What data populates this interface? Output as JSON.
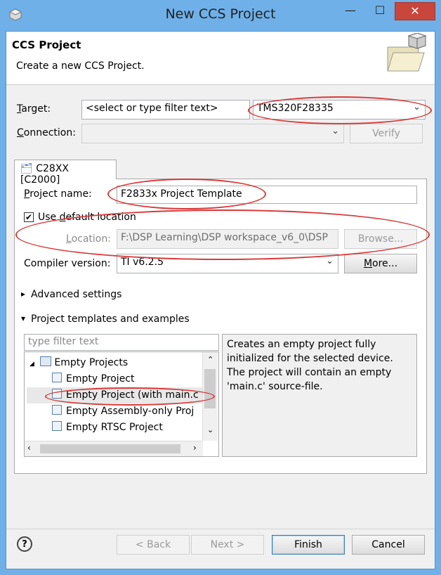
{
  "window": {
    "title": "New CCS Project",
    "min_icon": "—",
    "max_icon": "☐",
    "close_icon": "✕"
  },
  "header": {
    "title": "CCS Project",
    "description": "Create a new CCS Project."
  },
  "target": {
    "label_pre": "",
    "label_u": "T",
    "label_post": "arget:",
    "filter_placeholder": "<select or type filter text>",
    "value": "TMS320F28335"
  },
  "connection": {
    "label_u": "C",
    "label_post": "onnection:",
    "value": "",
    "verify_label": "Verify"
  },
  "tab": {
    "label": "C28XX [C2000]"
  },
  "project": {
    "name_label_u": "P",
    "name_label_post": "roject name:",
    "name_value": "F2833x Project Template",
    "use_default_label_pre": "Use ",
    "use_default_label_u": "d",
    "use_default_label_post": "efault location",
    "use_default_checked": "✔",
    "location_label_u": "L",
    "location_label_post": "ocation:",
    "location_value": "F:\\DSP Learning\\DSP workspace_v6_0\\DSP",
    "browse_label": "Browse...",
    "compiler_label": "Compiler version:",
    "compiler_value": "TI v6.2.5",
    "more_label_u": "M",
    "more_label_post": "ore..."
  },
  "sections": {
    "advanced": "Advanced settings",
    "templates": "Project templates and examples",
    "collapsed_arrow": "▸",
    "expanded_arrow": "▾"
  },
  "templates": {
    "filter_placeholder": "type filter text",
    "tree": [
      {
        "label": "Empty Projects",
        "indent": 0,
        "expander": "◢"
      },
      {
        "label": "Empty Project",
        "indent": 1
      },
      {
        "label": "Empty Project (with main.c",
        "indent": 1,
        "selected": true
      },
      {
        "label": "Empty Assembly-only Proj",
        "indent": 1
      },
      {
        "label": "Empty RTSC Project",
        "indent": 1
      }
    ],
    "description": "Creates an empty project fully initialized for the selected device. The project will contain an empty 'main.c' source-file."
  },
  "footer": {
    "help_icon": "?",
    "back_label": "< Back",
    "next_label": "Next >",
    "finish_label": "Finish",
    "cancel_label": "Cancel"
  },
  "colors": {
    "frame": "#6fb0e8",
    "annotation": "#d83a3a",
    "close": "#c9463d"
  }
}
